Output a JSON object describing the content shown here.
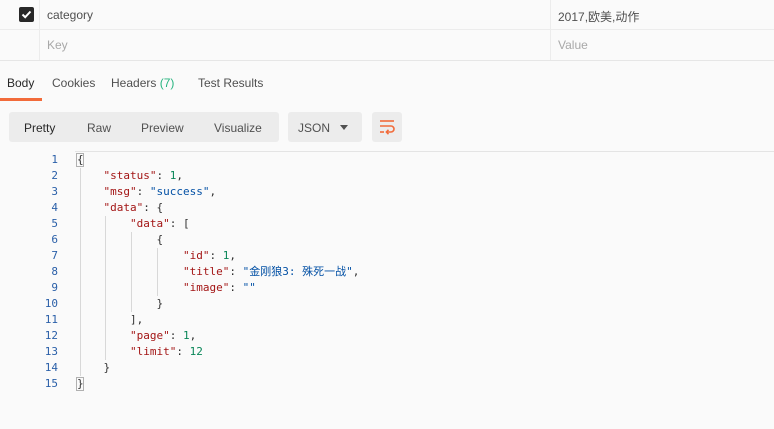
{
  "params": {
    "rows": [
      {
        "checked": true,
        "key": "category",
        "value": "2017,欧美,动作"
      },
      {
        "checked": false,
        "key_placeholder": "Key",
        "value_placeholder": "Value"
      }
    ]
  },
  "tabs": {
    "body": "Body",
    "cookies": "Cookies",
    "headers_label": "Headers",
    "headers_count": "(7)",
    "test_results": "Test Results"
  },
  "toolbar": {
    "pretty": "Pretty",
    "raw": "Raw",
    "preview": "Preview",
    "visualize": "Visualize",
    "format": "JSON",
    "wrap_icon": "wrap-lines-icon"
  },
  "colors": {
    "accent": "#f26b3a",
    "count": "#26b47f",
    "json_key": "#a31515",
    "json_string": "#0451a5",
    "json_number": "#098658",
    "line_number": "#2a5fa8"
  },
  "code": {
    "line_numbers": [
      "1",
      "2",
      "3",
      "4",
      "5",
      "6",
      "7",
      "8",
      "9",
      "10",
      "11",
      "12",
      "13",
      "14",
      "15"
    ],
    "tokens": {
      "brace_open": "{",
      "brace_close": "}",
      "status_key": "\"status\"",
      "status_val": "1",
      "msg_key": "\"msg\"",
      "msg_val": "\"success\"",
      "data_key": "\"data\"",
      "inner_data_key": "\"data\"",
      "bracket_open": "[",
      "bracket_close": "],",
      "id_key": "\"id\"",
      "id_val": "1",
      "title_key": "\"title\"",
      "title_val": "\"金刚狼3: 殊死一战\"",
      "image_key": "\"image\"",
      "image_val": "\"\"",
      "page_key": "\"page\"",
      "page_val": "1",
      "limit_key": "\"limit\"",
      "limit_val": "12"
    }
  }
}
